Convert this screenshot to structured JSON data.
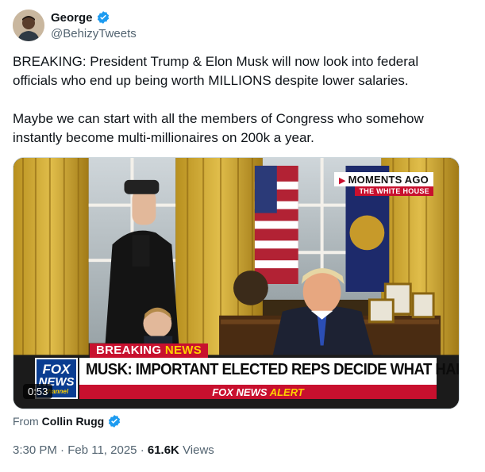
{
  "author": {
    "display_name": "George",
    "handle": "@BehizyTweets",
    "verified_icon": "verified-badge-icon"
  },
  "tweet": {
    "paragraph_1": "BREAKING: President Trump & Elon Musk will now look into federal officials who end up being worth MILLIONS despite lower salaries.",
    "paragraph_2": "Maybe we can start with all the members of Congress who somehow instantly become multi-millionaires on 200k a year."
  },
  "video": {
    "overlay_top": "MOMENTS AGO",
    "overlay_location": "THE WHITE HOUSE",
    "breaking_word_1": "BREAKING",
    "breaking_word_2": "NEWS",
    "headline": "MUSK: IMPORTANT ELECTED REPS DECIDE WHAT HAPPENS",
    "alert_part_1": "FOX NEWS",
    "alert_part_2": "ALERT",
    "logo_line_1": "FOX",
    "logo_line_2": "NEWS",
    "logo_line_3": "channel",
    "duration": "0:53"
  },
  "source": {
    "prefix": "From",
    "name": "Collin Rugg"
  },
  "meta": {
    "time": "3:30 PM",
    "separator_1": "·",
    "date": "Feb 11, 2025",
    "separator_2": "·",
    "views_count": "61.6K",
    "views_label": "Views"
  },
  "colors": {
    "verified_blue": "#1d9bf0",
    "fox_red": "#c8102e",
    "fox_blue": "#0a3d91",
    "secondary_text": "#536471"
  }
}
